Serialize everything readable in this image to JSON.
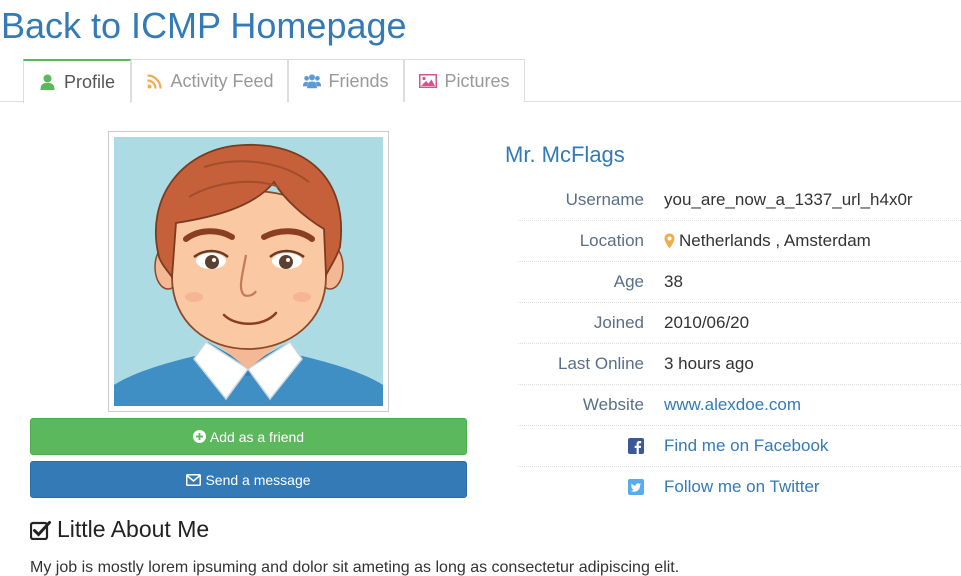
{
  "header": {
    "back_link": "Back to ICMP Homepage"
  },
  "tabs": [
    {
      "label": "Profile",
      "icon": "user-icon",
      "active": true
    },
    {
      "label": "Activity Feed",
      "icon": "rss-icon",
      "active": false
    },
    {
      "label": "Friends",
      "icon": "users-icon",
      "active": false
    },
    {
      "label": "Pictures",
      "icon": "picture-icon",
      "active": false
    }
  ],
  "actions": {
    "add_friend": "Add as a friend",
    "send_message": "Send a message"
  },
  "about": {
    "title": "Little About Me",
    "text": "My job is mostly lorem ipsuming and dolor sit ameting as long as consectetur adipiscing elit."
  },
  "profile": {
    "name": "Mr. McFlags",
    "rows": [
      {
        "label": "Username",
        "value": "you_are_now_a_1337_url_h4x0r"
      },
      {
        "label": "Location",
        "value": "Netherlands , Amsterdam"
      },
      {
        "label": "Age",
        "value": "38"
      },
      {
        "label": "Joined",
        "value": "2010/06/20"
      },
      {
        "label": "Last Online",
        "value": "3 hours ago"
      },
      {
        "label": "Website",
        "value": "www.alexdoe.com"
      }
    ],
    "social": [
      {
        "icon": "facebook-icon",
        "value": "Find me on Facebook"
      },
      {
        "icon": "twitter-icon",
        "value": "Follow me on Twitter"
      }
    ]
  },
  "colors": {
    "link": "#337ab7",
    "success": "#5cb85c",
    "primary": "#337ab7",
    "location_pin": "#f0ad4e",
    "facebook": "#3b5998",
    "twitter": "#55acee"
  }
}
